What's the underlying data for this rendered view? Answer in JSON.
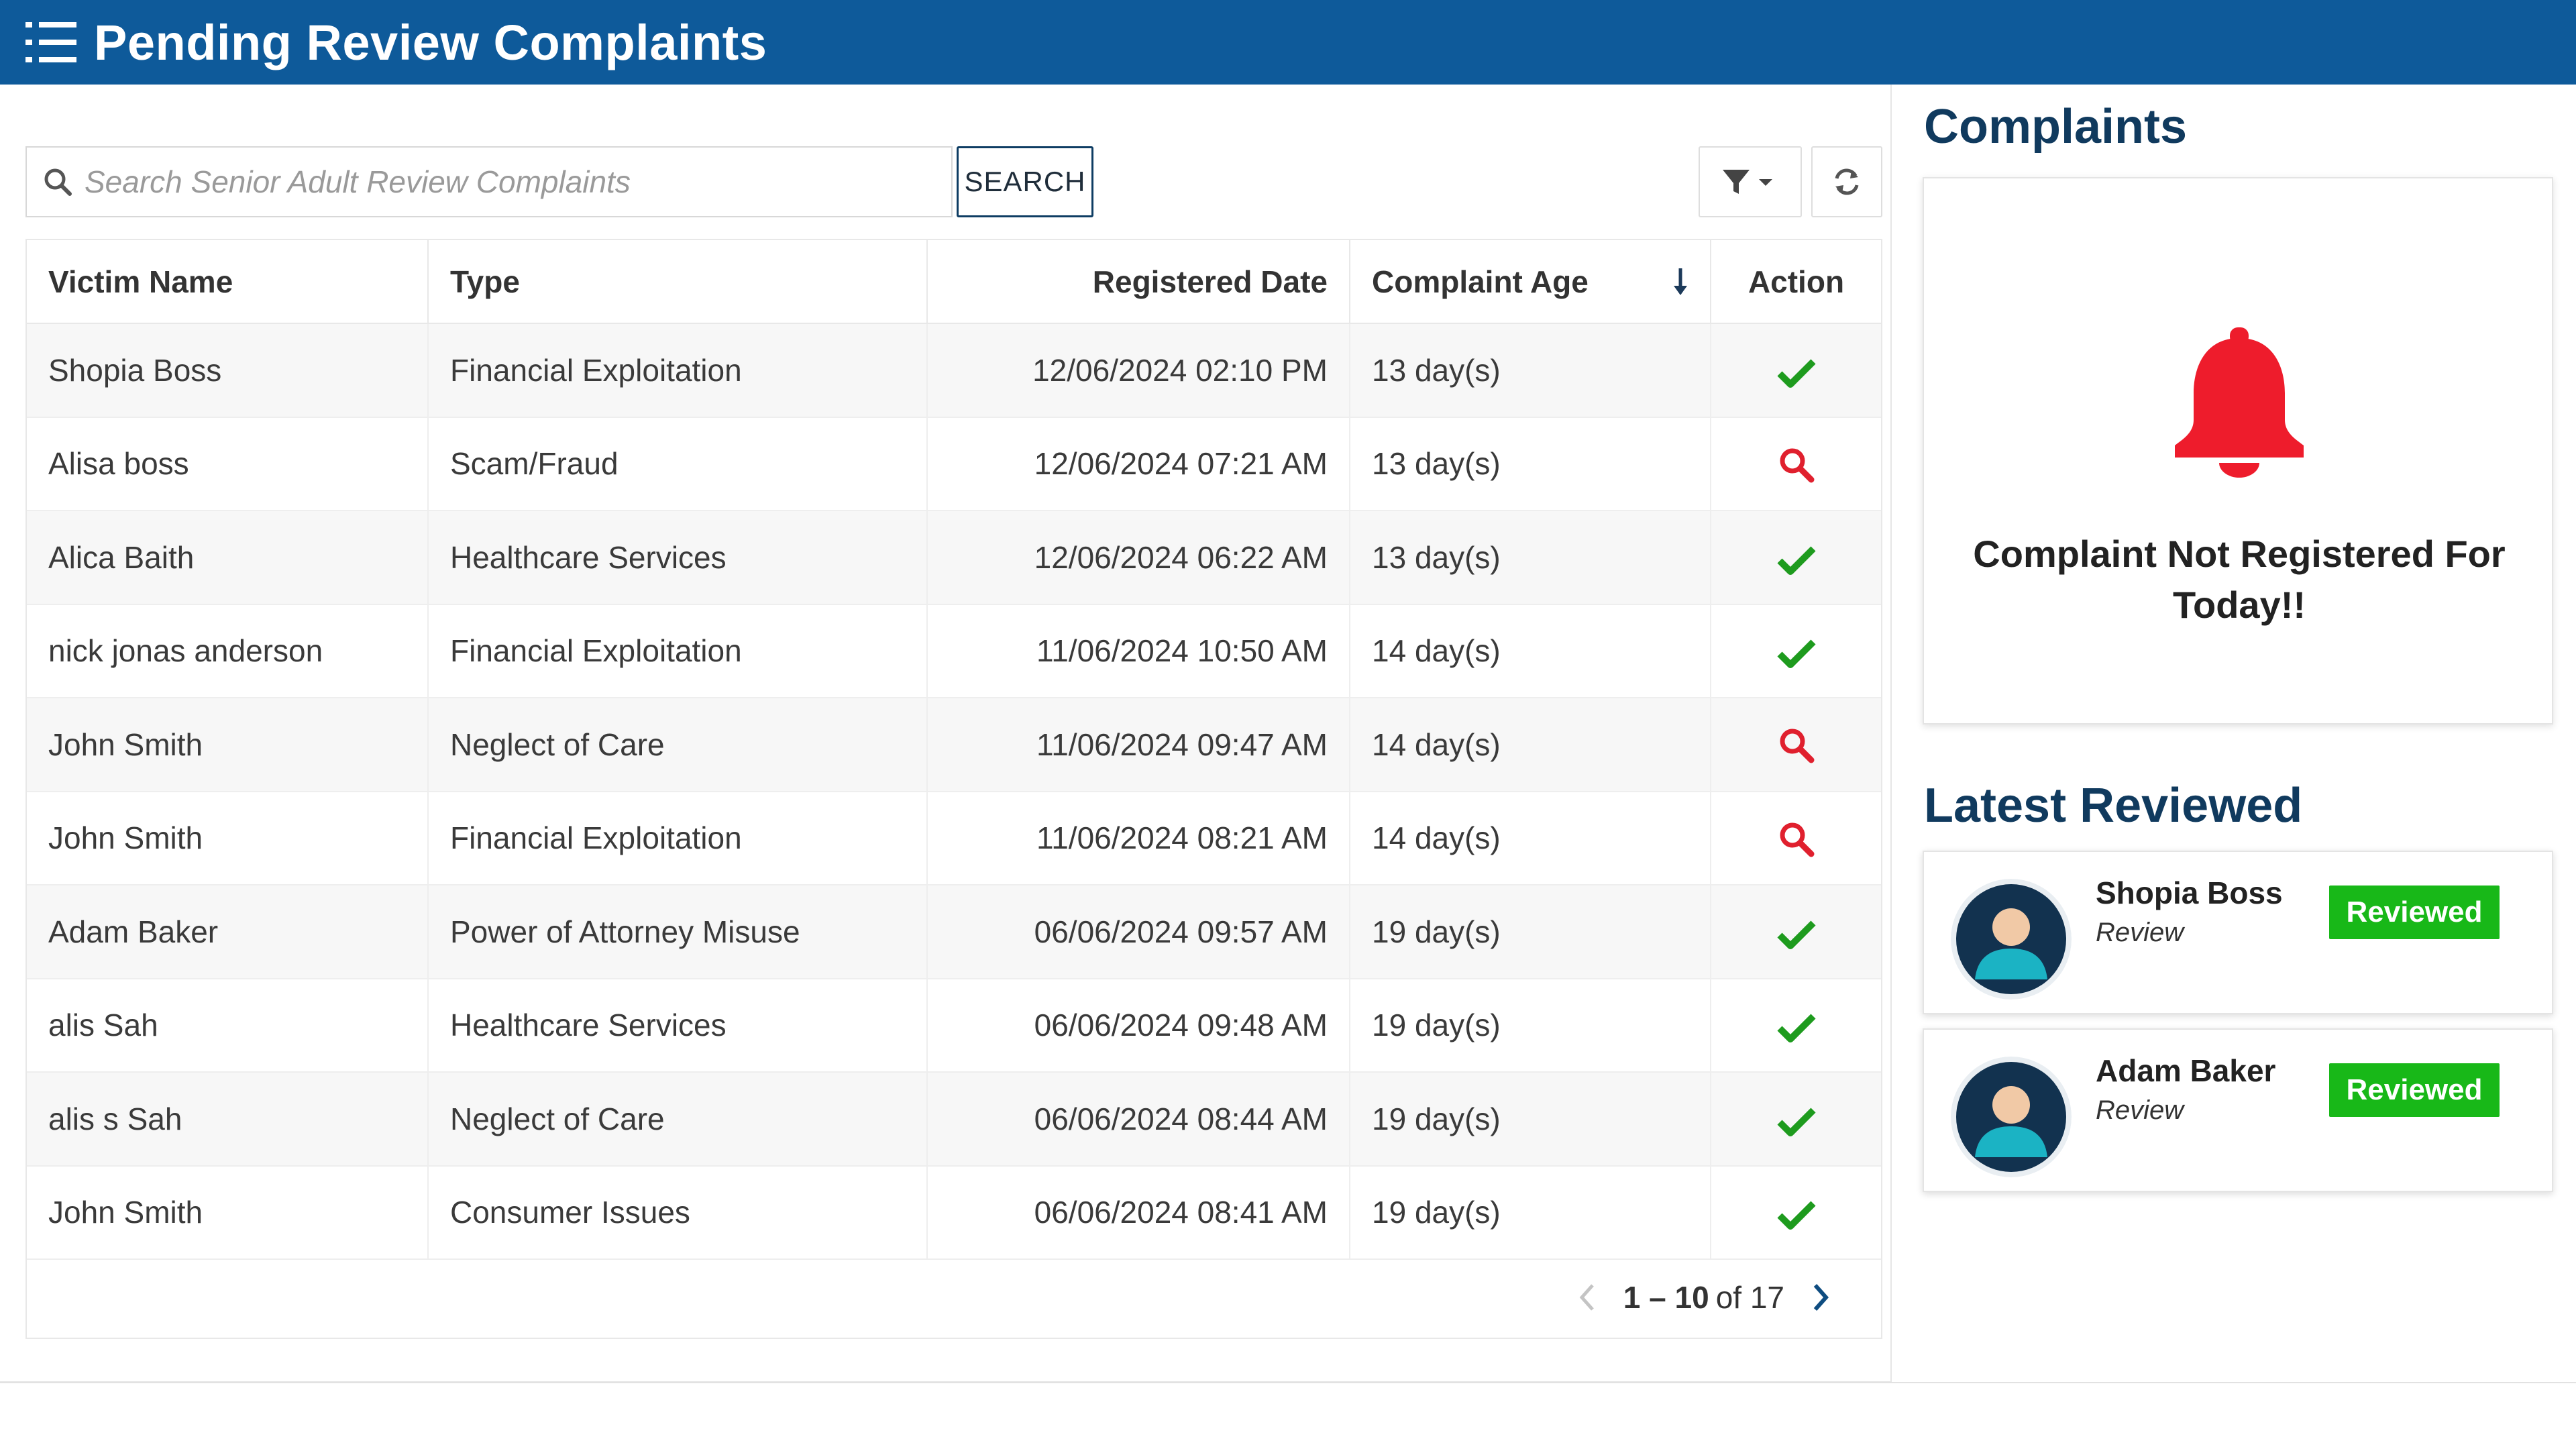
{
  "header": {
    "title": "Pending Review Complaints",
    "menu_icon": "list-menu-icon",
    "bg_color": "#0e5a9a"
  },
  "search": {
    "placeholder": "Search Senior Adult Review Complaints",
    "button_label": "SEARCH"
  },
  "toolbar": {
    "filter_icon": "filter-icon",
    "refresh_icon": "refresh-icon"
  },
  "table": {
    "columns": [
      "Victim Name",
      "Type",
      "Registered Date",
      "Complaint Age",
      "Action"
    ],
    "sorted_column": "Complaint Age",
    "sort_direction": "descending",
    "rows": [
      {
        "name": "Shopia  Boss",
        "type": "Financial Exploitation",
        "date": "12/06/2024 02:10 PM",
        "age": "13 day(s)",
        "action": "approve-check-icon"
      },
      {
        "name": "Alisa  boss",
        "type": "Scam/Fraud",
        "date": "12/06/2024 07:21 AM",
        "age": "13 day(s)",
        "action": "review-search-icon"
      },
      {
        "name": "Alica  Baith",
        "type": "Healthcare Services",
        "date": "12/06/2024 06:22 AM",
        "age": "13 day(s)",
        "action": "approve-check-icon"
      },
      {
        "name": "nick jonas anderson",
        "type": "Financial Exploitation",
        "date": "11/06/2024 10:50 AM",
        "age": "14 day(s)",
        "action": "approve-check-icon"
      },
      {
        "name": "John  Smith",
        "type": "Neglect of Care",
        "date": "11/06/2024 09:47 AM",
        "age": "14 day(s)",
        "action": "review-search-icon"
      },
      {
        "name": "John  Smith",
        "type": "Financial Exploitation",
        "date": "11/06/2024 08:21 AM",
        "age": "14 day(s)",
        "action": "review-search-icon"
      },
      {
        "name": "Adam  Baker",
        "type": "Power of Attorney Misuse",
        "date": "06/06/2024 09:57 AM",
        "age": "19 day(s)",
        "action": "approve-check-icon"
      },
      {
        "name": "alis  Sah",
        "type": "Healthcare Services",
        "date": "06/06/2024 09:48 AM",
        "age": "19 day(s)",
        "action": "approve-check-icon"
      },
      {
        "name": "alis s Sah",
        "type": "Neglect of Care",
        "date": "06/06/2024 08:44 AM",
        "age": "19 day(s)",
        "action": "approve-check-icon"
      },
      {
        "name": "John  Smith",
        "type": "Consumer Issues",
        "date": "06/06/2024 08:41 AM",
        "age": "19 day(s)",
        "action": "approve-check-icon"
      }
    ]
  },
  "pagination": {
    "range": "1 – 10",
    "of_text": "of 17"
  },
  "sidebar": {
    "complaints_heading": "Complaints",
    "alert_icon": "bell-icon",
    "alert_message": "Complaint Not Registered For Today!!",
    "latest_heading": "Latest Reviewed",
    "reviews": [
      {
        "name": "Shopia Boss",
        "subtitle": "Review",
        "badge": "Reviewed"
      },
      {
        "name": "Adam Baker",
        "subtitle": "Review",
        "badge": "Reviewed"
      }
    ]
  },
  "colors": {
    "check": "#1e9b1e",
    "search_action": "#e0202e",
    "bell": "#ee1c2c",
    "badge": "#18b818",
    "heading": "#103a5e"
  }
}
